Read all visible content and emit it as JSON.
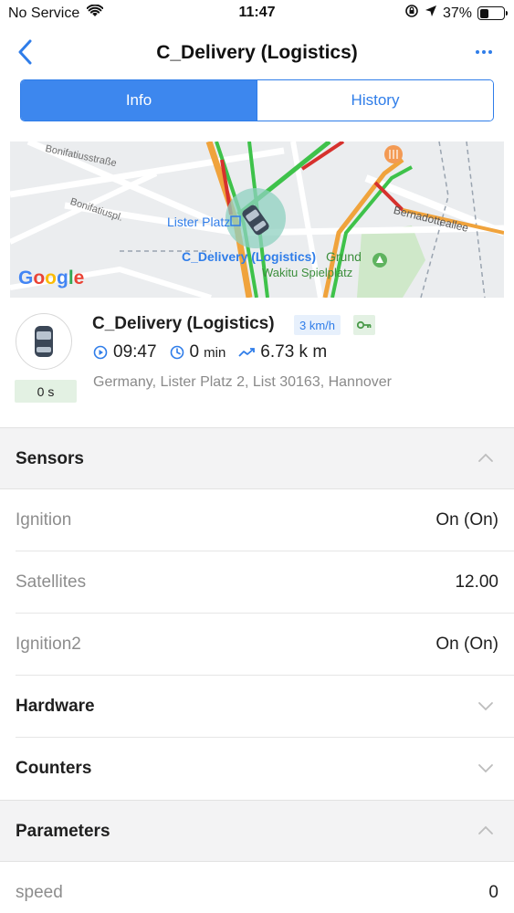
{
  "status_bar": {
    "carrier": "No Service",
    "time": "11:47",
    "battery": "37%",
    "battery_level": 0.37
  },
  "nav": {
    "title": "C_Delivery (Logistics)"
  },
  "tabs": [
    {
      "label": "Info",
      "active": true
    },
    {
      "label": "History",
      "active": false
    }
  ],
  "map": {
    "streets": [
      "Bonifatiusstraße",
      "Bonifatiuspl.",
      "Bernadotteallee",
      "Lister Platz",
      "Wakitu Spielplatz",
      "Grund"
    ],
    "unit_label": "C_Delivery (Logistics)",
    "brand": "Google"
  },
  "unit": {
    "name": "C_Delivery (Logistics)",
    "speed": "3 km/h",
    "time": "09:47",
    "duration_value": "0",
    "duration_unit": "min",
    "distance": "6.73 k m",
    "address": "Germany, Lister Platz 2, List 30163, Hannover",
    "last_update": "0 s"
  },
  "sections": {
    "sensors": {
      "label": "Sensors",
      "rows": [
        {
          "key": "Ignition",
          "value": "On (On)"
        },
        {
          "key": "Satellites",
          "value": "12.00"
        },
        {
          "key": "Ignition2",
          "value": "On (On)"
        }
      ]
    },
    "hardware": {
      "label": "Hardware"
    },
    "counters": {
      "label": "Counters"
    },
    "parameters": {
      "label": "Parameters",
      "rows": [
        {
          "key": "speed",
          "value": "0"
        }
      ]
    }
  },
  "colors": {
    "accent": "#2f7de9",
    "badge_green": "#e3f1e3",
    "badge_blue": "#e7f0fc"
  }
}
